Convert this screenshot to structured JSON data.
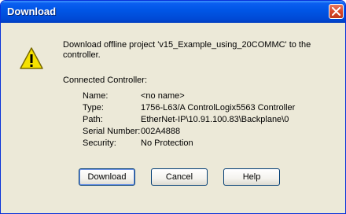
{
  "window": {
    "title": "Download"
  },
  "message": "Download offline project 'v15_Example_using_20COMMC' to the controller.",
  "connected_controller": {
    "heading": "Connected Controller:",
    "fields": [
      {
        "label": "Name:",
        "value": "<no name>"
      },
      {
        "label": "Type:",
        "value": "1756-L63/A ControlLogix5563 Controller"
      },
      {
        "label": "Path:",
        "value": "EtherNet-IP\\10.91.100.83\\Backplane\\0"
      },
      {
        "label": "Serial Number:",
        "value": "002A4888"
      },
      {
        "label": "Security:",
        "value": "No Protection"
      }
    ]
  },
  "buttons": {
    "download": "Download",
    "cancel": "Cancel",
    "help": "Help"
  },
  "icons": {
    "warning": "warning-icon",
    "close": "close-icon"
  }
}
